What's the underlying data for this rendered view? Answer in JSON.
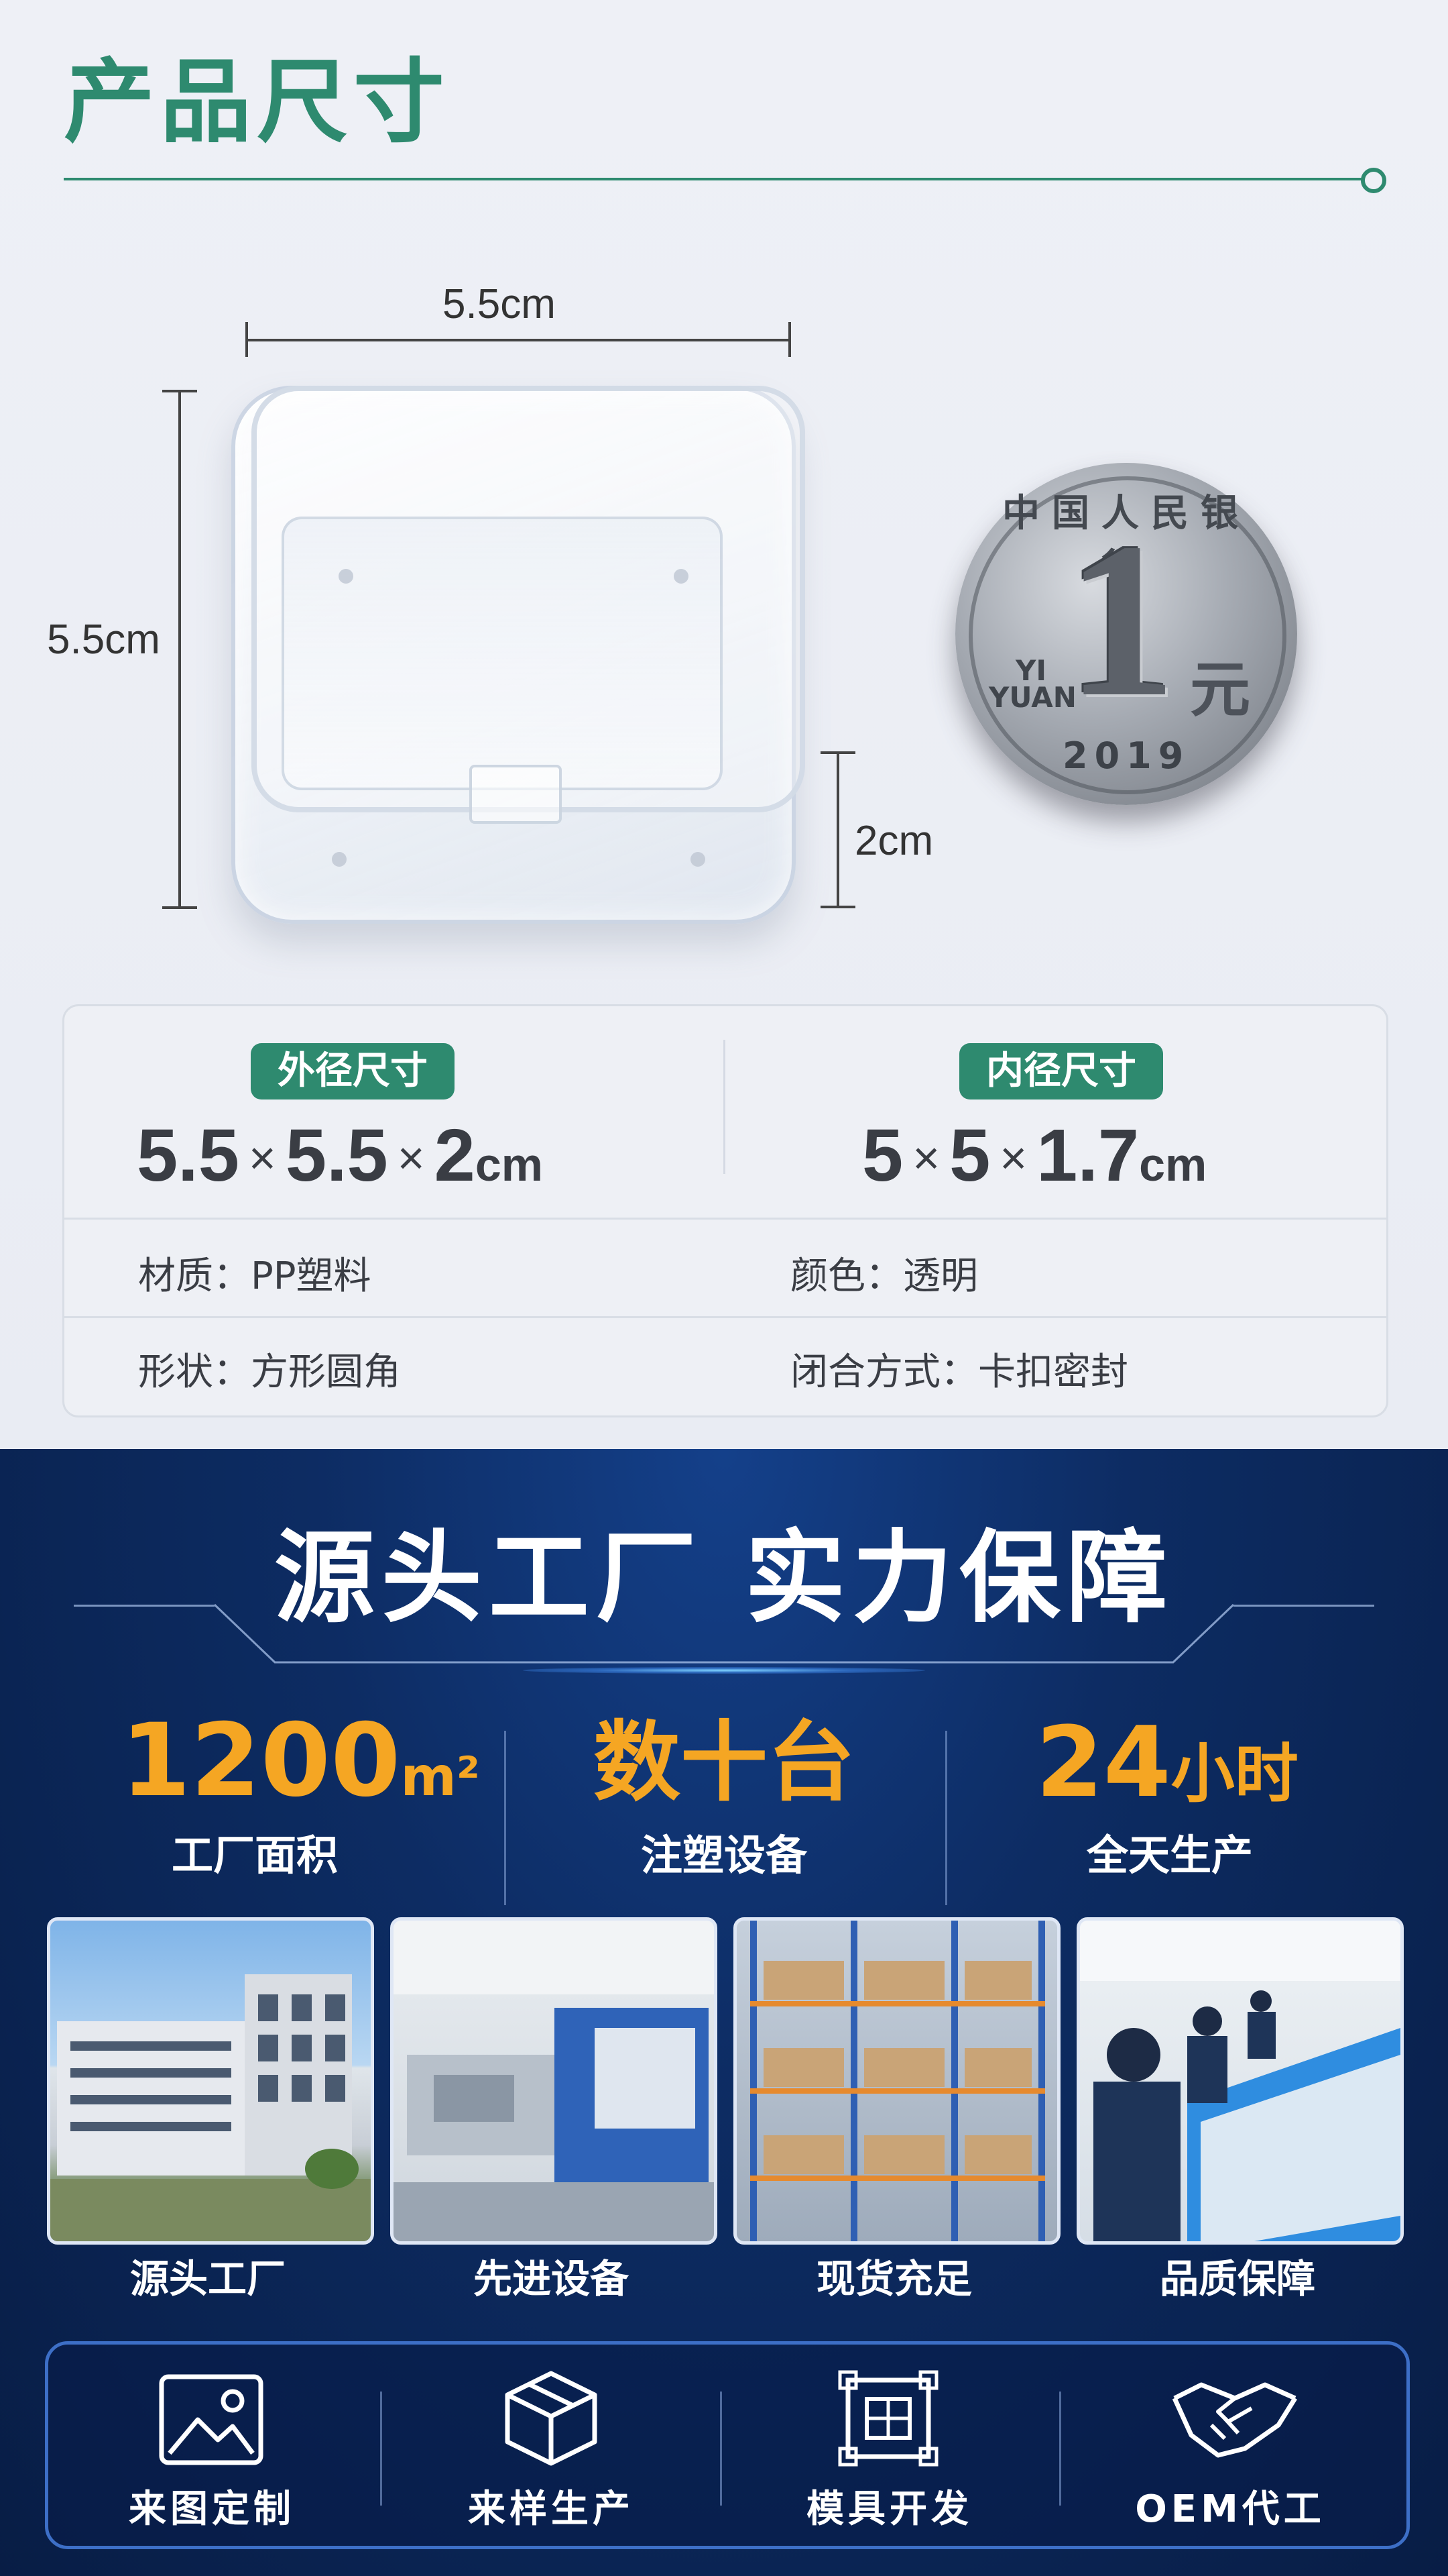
{
  "header": {
    "title": "产品尺寸"
  },
  "dimensions": {
    "width": "5.5cm",
    "depth": "5.5cm",
    "height": "2cm"
  },
  "coin": {
    "top_text": "中国人民银行",
    "denomination": "1",
    "unit": "元",
    "pinyin_1": "YI",
    "pinyin_2": "YUAN",
    "year": "2019"
  },
  "spec": {
    "outer_label": "外径尺寸",
    "outer": {
      "a": "5.5",
      "b": "5.5",
      "c": "2",
      "unit": "cm",
      "sep": "×"
    },
    "inner_label": "内径尺寸",
    "inner": {
      "a": "5",
      "b": "5",
      "c": "1.7",
      "unit": "cm",
      "sep": "×"
    },
    "material": "材质：PP塑料",
    "color": "颜色：透明",
    "shape": "形状：方形圆角",
    "closure": "闭合方式：卡扣密封"
  },
  "factory": {
    "title": "源头工厂  实力保障",
    "stats": [
      {
        "value": "1200",
        "unit": "m²",
        "label": "工厂面积"
      },
      {
        "value": "数十台",
        "unit": "",
        "label": "注塑设备"
      },
      {
        "value": "24",
        "unit": "小时",
        "label": "全天生产"
      }
    ],
    "photos": [
      {
        "label": "源头工厂"
      },
      {
        "label": "先进设备"
      },
      {
        "label": "现货充足"
      },
      {
        "label": "品质保障"
      }
    ],
    "services": [
      {
        "label": "来图定制",
        "icon": "image-icon"
      },
      {
        "label": "来样生产",
        "icon": "package-icon"
      },
      {
        "label": "模具开发",
        "icon": "mold-icon"
      },
      {
        "label": "OEM代工",
        "icon": "handshake-icon"
      }
    ]
  },
  "colors": {
    "accent_green": "#2e8a6f",
    "accent_orange": "#f5a623",
    "navy": "#0d2c63"
  }
}
